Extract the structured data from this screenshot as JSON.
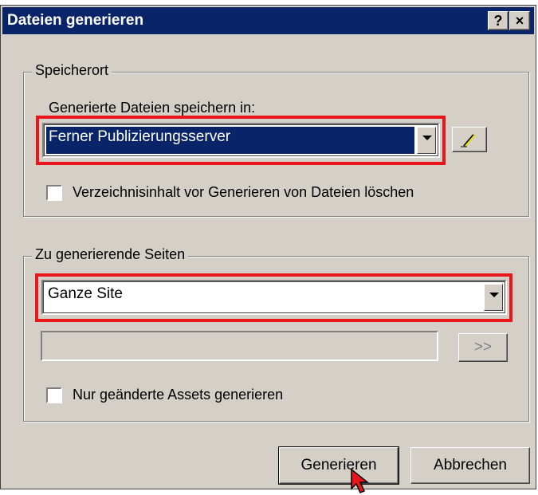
{
  "dialog": {
    "title": "Dateien generieren",
    "help_label": "?",
    "close_label": "×"
  },
  "storage": {
    "group_label": "Speicherort",
    "save_label": "Generierte Dateien speichern in:",
    "selected_value": "Ferner Publizierungsserver",
    "clear_checkbox_label": "Verzeichnisinhalt vor Generieren von Dateien löschen",
    "clear_checked": false
  },
  "pages": {
    "group_label": "Zu generierende Seiten",
    "selected_value": "Ganze Site",
    "path_value": "",
    "browse_label": ">>",
    "changed_checkbox_label": "Nur geänderte Assets generieren",
    "changed_checked": false
  },
  "buttons": {
    "generate_label": "Generieren",
    "cancel_label": "Abbrechen"
  },
  "colors": {
    "titlebar": "#0a246a",
    "highlight": "#e8161b",
    "dialog_face": "#d4d0c8"
  }
}
